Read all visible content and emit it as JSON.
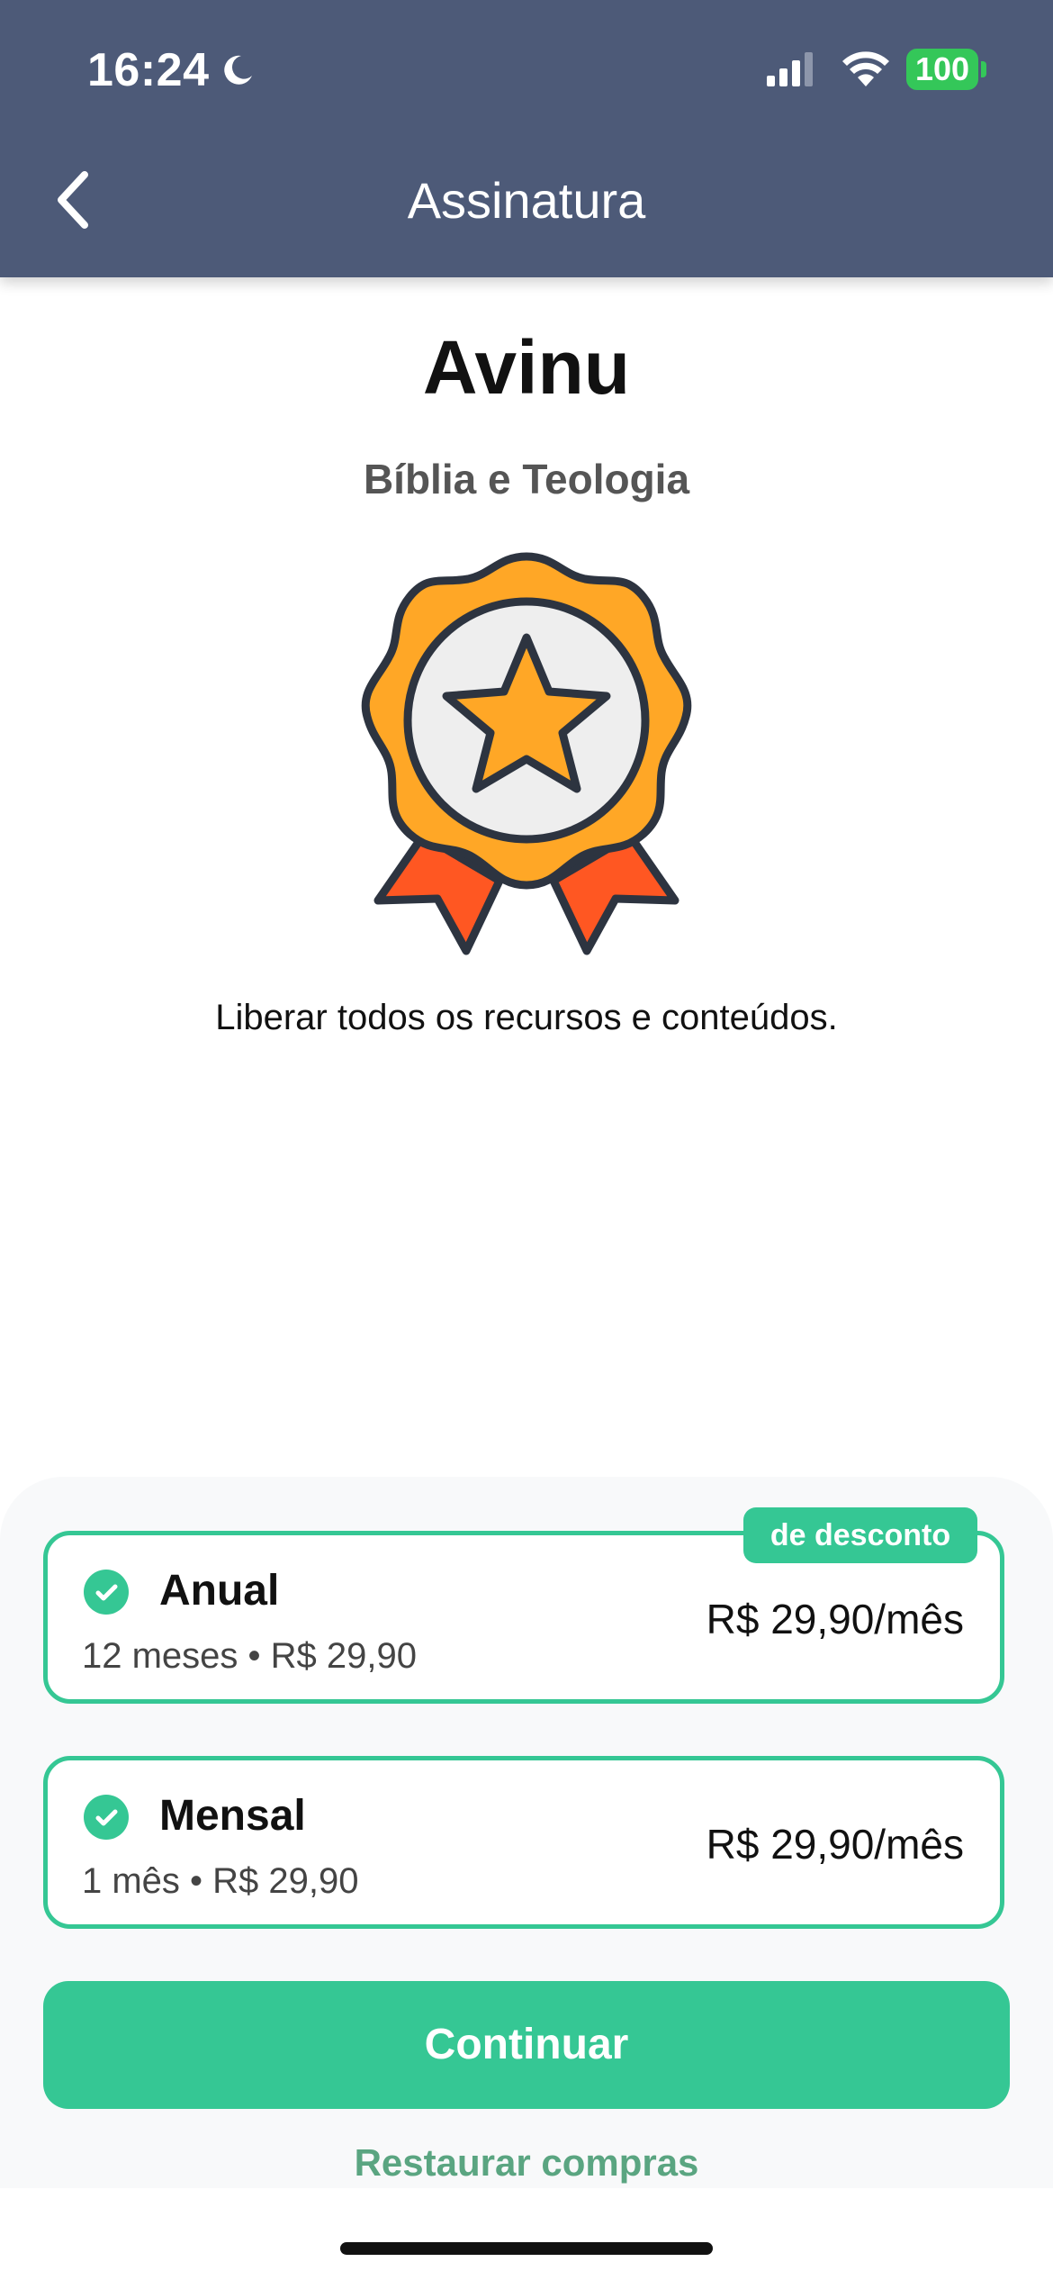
{
  "status_bar": {
    "time": "16:24",
    "battery": "100",
    "icons": [
      "moon-icon",
      "signal-icon",
      "wifi-icon",
      "battery-icon"
    ]
  },
  "header": {
    "title": "Assinatura",
    "back_icon": "chevron-left-icon"
  },
  "app": {
    "name": "Avinu",
    "subtitle": "Bíblia e Teologia",
    "illustration": "award-ribbon-icon",
    "tagline": "Liberar todos os recursos e conteúdos."
  },
  "plans": [
    {
      "name": "Anual",
      "detail": "12 meses • R$ 29,90",
      "price": "R$ 29,90/mês",
      "badge": "de desconto",
      "selected": true
    },
    {
      "name": "Mensal",
      "detail": "1 mês • R$ 29,90",
      "price": "R$ 29,90/mês",
      "selected": true
    }
  ],
  "actions": {
    "continue_label": "Continuar",
    "restore_label": "Restaurar compras"
  },
  "colors": {
    "header_bg": "#4d5a78",
    "accent": "#35c794",
    "restore_text": "#5aa581",
    "award_orange": "#ffa726",
    "ribbon_red": "#ff5722"
  }
}
